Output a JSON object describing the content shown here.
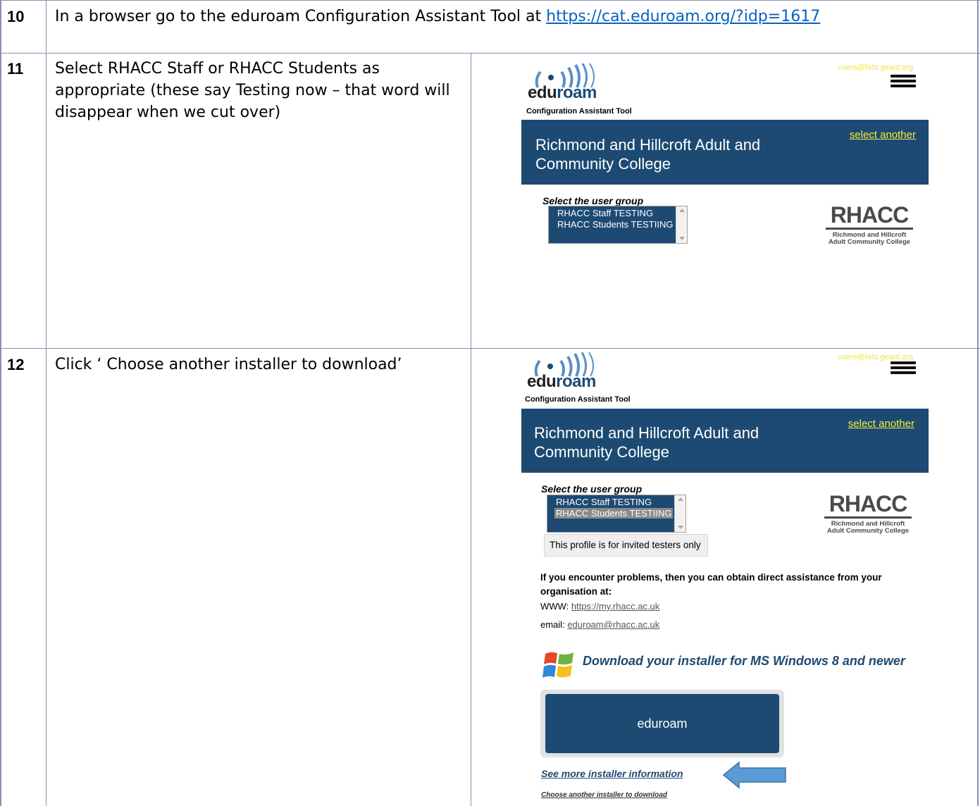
{
  "rows": [
    {
      "number": "10",
      "text_before": "In a browser go to the eduroam Configuration Assistant Tool at",
      "link": "https://cat.eduroam.org/?idp=1617"
    },
    {
      "number": "11",
      "text": "Select RHACC Staff or RHACC Students as appropriate (these say Testing now – that word will disappear when we cut over)"
    },
    {
      "number": "12",
      "text": "Click ‘ Choose another installer to download’"
    }
  ],
  "cat_page": {
    "logo_part1": "edu",
    "logo_part2": "roam",
    "subtitle": "Configuration Assistant Tool",
    "users_link": "users@lists.geant.org",
    "institution": "Richmond and Hillcroft Adult and Community College",
    "select_another": "select another",
    "user_group_label": "Select the user group",
    "profiles": [
      "RHACC Staff TESTING",
      "RHACC Students TESTIING"
    ],
    "rhacc_logo": {
      "acronym": "RHACC",
      "line1": "Richmond and Hillcroft",
      "line2": "Adult Community College"
    },
    "profile_note": "This profile is for invited testers only",
    "problems_text": "If you encounter problems, then you can obtain direct assistance from your organisation at:",
    "www_label": "WWW:",
    "www_url": "https://my.rhacc.ac.uk",
    "email_label": "email:",
    "email": "eduroam@rhacc.ac.uk",
    "download_title": "Download your installer for MS Windows 8 and newer",
    "download_button": "eduroam",
    "more_info_link": "See more installer information",
    "choose_another_link": "Choose another installer to download"
  },
  "colors": {
    "banner": "#1d4a72",
    "link_yellow": "#f5ec3a",
    "grid": "#8a8fb8",
    "arrow": "#5b9bd5"
  }
}
